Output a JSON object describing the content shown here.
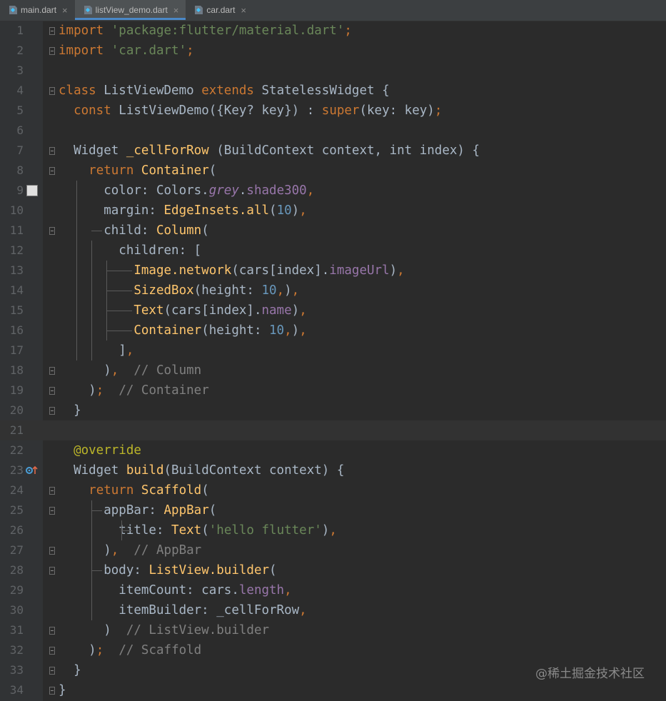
{
  "tabs": [
    {
      "name": "main.dart",
      "active": false
    },
    {
      "name": "listView_demo.dart",
      "active": true
    },
    {
      "name": "car.dart",
      "active": false
    }
  ],
  "editor": {
    "highlighted_line": 21,
    "lines": [
      {
        "n": "1",
        "t": [
          [
            "kw",
            "import"
          ],
          [
            "p",
            " "
          ],
          [
            "str",
            "'package:flutter/material.dart'"
          ],
          [
            "kw",
            ";"
          ]
        ]
      },
      {
        "n": "2",
        "t": [
          [
            "kw",
            "import"
          ],
          [
            "p",
            " "
          ],
          [
            "str",
            "'car.dart'"
          ],
          [
            "kw",
            ";"
          ]
        ]
      },
      {
        "n": "3",
        "t": []
      },
      {
        "n": "4",
        "t": [
          [
            "kw",
            "class"
          ],
          [
            "p",
            " ListViewDemo "
          ],
          [
            "kw",
            "extends"
          ],
          [
            "p",
            " StatelessWidget {"
          ]
        ]
      },
      {
        "n": "5",
        "t": [
          [
            "p",
            "  "
          ],
          [
            "kw",
            "const"
          ],
          [
            "p",
            " ListViewDemo({Key? key}) : "
          ],
          [
            "kw",
            "super"
          ],
          [
            "p",
            "(key: key)"
          ],
          [
            "kw",
            ";"
          ]
        ]
      },
      {
        "n": "6",
        "t": []
      },
      {
        "n": "7",
        "t": [
          [
            "p",
            "  Widget "
          ],
          [
            "fn",
            "_cellForRow"
          ],
          [
            "p",
            " (BuildContext context, int index) {"
          ]
        ]
      },
      {
        "n": "8",
        "t": [
          [
            "p",
            "    "
          ],
          [
            "kw",
            "return"
          ],
          [
            "p",
            " "
          ],
          [
            "fn",
            "Container"
          ],
          [
            "p",
            "("
          ]
        ]
      },
      {
        "n": "9",
        "t": [
          [
            "p",
            "      color: Colors."
          ],
          [
            "it",
            "grey"
          ],
          [
            "p",
            "."
          ],
          [
            "fld",
            "shade300"
          ],
          [
            "kw",
            ","
          ]
        ]
      },
      {
        "n": "10",
        "t": [
          [
            "p",
            "      margin: "
          ],
          [
            "fn",
            "EdgeInsets.all"
          ],
          [
            "p",
            "("
          ],
          [
            "num",
            "10"
          ],
          [
            "p",
            ")"
          ],
          [
            "kw",
            ","
          ]
        ]
      },
      {
        "n": "11",
        "t": [
          [
            "p",
            "      child: "
          ],
          [
            "fn",
            "Column"
          ],
          [
            "p",
            "("
          ]
        ]
      },
      {
        "n": "12",
        "t": [
          [
            "p",
            "        children: ["
          ]
        ]
      },
      {
        "n": "13",
        "t": [
          [
            "p",
            "          "
          ],
          [
            "fn",
            "Image.network"
          ],
          [
            "p",
            "(cars[index]."
          ],
          [
            "fld",
            "imageUrl"
          ],
          [
            "p",
            ")"
          ],
          [
            "kw",
            ","
          ]
        ]
      },
      {
        "n": "14",
        "t": [
          [
            "p",
            "          "
          ],
          [
            "fn",
            "SizedBox"
          ],
          [
            "p",
            "(height: "
          ],
          [
            "num",
            "10"
          ],
          [
            "kw",
            ","
          ],
          [
            "p",
            ")"
          ],
          [
            "kw",
            ","
          ]
        ]
      },
      {
        "n": "15",
        "t": [
          [
            "p",
            "          "
          ],
          [
            "fn",
            "Text"
          ],
          [
            "p",
            "(cars[index]."
          ],
          [
            "fld",
            "name"
          ],
          [
            "p",
            ")"
          ],
          [
            "kw",
            ","
          ]
        ]
      },
      {
        "n": "16",
        "t": [
          [
            "p",
            "          "
          ],
          [
            "fn",
            "Container"
          ],
          [
            "p",
            "(height: "
          ],
          [
            "num",
            "10"
          ],
          [
            "kw",
            ","
          ],
          [
            "p",
            ")"
          ],
          [
            "kw",
            ","
          ]
        ]
      },
      {
        "n": "17",
        "t": [
          [
            "p",
            "        ]"
          ],
          [
            "kw",
            ","
          ]
        ]
      },
      {
        "n": "18",
        "t": [
          [
            "p",
            "      )"
          ],
          [
            "kw",
            ","
          ],
          [
            "p",
            "  "
          ],
          [
            "cm",
            "// Column"
          ]
        ]
      },
      {
        "n": "19",
        "t": [
          [
            "p",
            "    )"
          ],
          [
            "kw",
            ";"
          ],
          [
            "p",
            "  "
          ],
          [
            "cm",
            "// Container"
          ]
        ]
      },
      {
        "n": "20",
        "t": [
          [
            "p",
            "  }"
          ]
        ]
      },
      {
        "n": "21",
        "t": []
      },
      {
        "n": "22",
        "t": [
          [
            "p",
            "  "
          ],
          [
            "ann",
            "@override"
          ]
        ]
      },
      {
        "n": "23",
        "t": [
          [
            "p",
            "  Widget "
          ],
          [
            "fn",
            "build"
          ],
          [
            "p",
            "(BuildContext context) {"
          ]
        ]
      },
      {
        "n": "24",
        "t": [
          [
            "p",
            "    "
          ],
          [
            "kw",
            "return"
          ],
          [
            "p",
            " "
          ],
          [
            "fn",
            "Scaffold"
          ],
          [
            "p",
            "("
          ]
        ]
      },
      {
        "n": "25",
        "t": [
          [
            "p",
            "      appBar: "
          ],
          [
            "fn",
            "AppBar"
          ],
          [
            "p",
            "("
          ]
        ]
      },
      {
        "n": "26",
        "t": [
          [
            "p",
            "        title: "
          ],
          [
            "fn",
            "Text"
          ],
          [
            "p",
            "("
          ],
          [
            "str",
            "'hello flutter'"
          ],
          [
            "p",
            ")"
          ],
          [
            "kw",
            ","
          ]
        ]
      },
      {
        "n": "27",
        "t": [
          [
            "p",
            "      )"
          ],
          [
            "kw",
            ","
          ],
          [
            "p",
            "  "
          ],
          [
            "cm",
            "// AppBar"
          ]
        ]
      },
      {
        "n": "28",
        "t": [
          [
            "p",
            "      body: "
          ],
          [
            "fn",
            "ListView.builder"
          ],
          [
            "p",
            "("
          ]
        ]
      },
      {
        "n": "29",
        "t": [
          [
            "p",
            "        itemCount: cars."
          ],
          [
            "fld",
            "length"
          ],
          [
            "kw",
            ","
          ]
        ]
      },
      {
        "n": "30",
        "t": [
          [
            "p",
            "        itemBuilder: _cellForRow"
          ],
          [
            "kw",
            ","
          ]
        ]
      },
      {
        "n": "31",
        "t": [
          [
            "p",
            "      )  "
          ],
          [
            "cm",
            "// ListView.builder"
          ]
        ]
      },
      {
        "n": "32",
        "t": [
          [
            "p",
            "    )"
          ],
          [
            "kw",
            ";"
          ],
          [
            "p",
            "  "
          ],
          [
            "cm",
            "// Scaffold"
          ]
        ]
      },
      {
        "n": "33",
        "t": [
          [
            "p",
            "  }"
          ]
        ]
      },
      {
        "n": "34",
        "t": [
          [
            "p",
            "}"
          ]
        ]
      }
    ]
  },
  "gutter_markers": {
    "color_preview_line": 9,
    "color_preview_hex": "#e0e0e0",
    "override_line": 23
  },
  "watermark": "@稀土掘金技术社区"
}
